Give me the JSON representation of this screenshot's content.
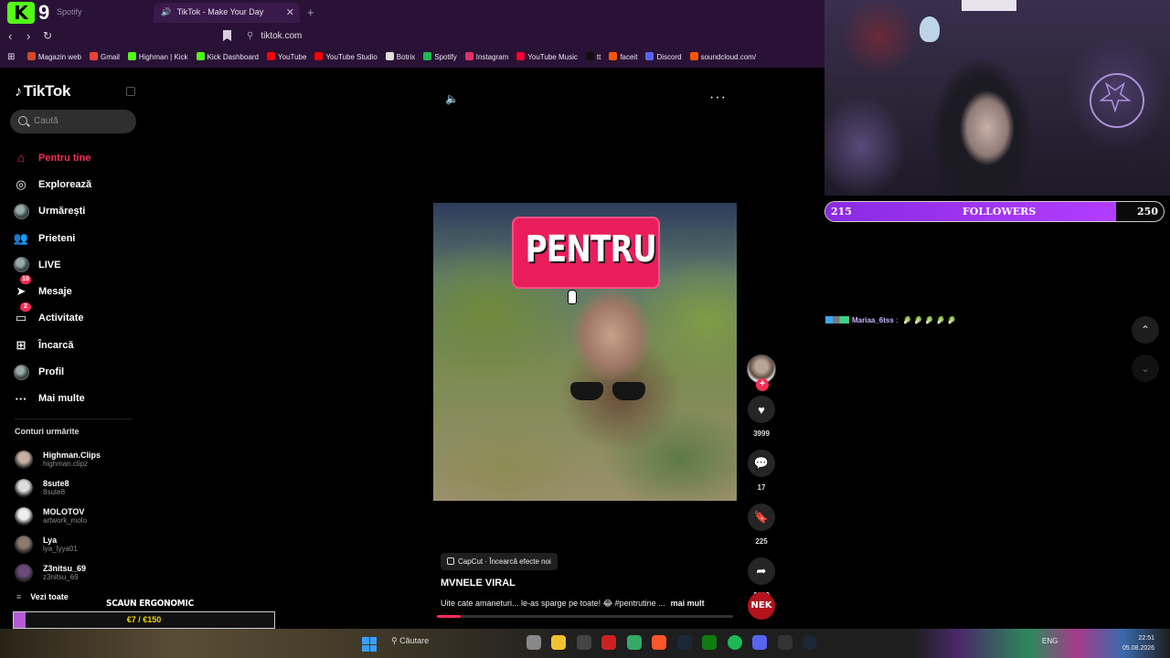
{
  "browser": {
    "inactive_tab_label": "Spotify",
    "active_tab_title": "TikTok - Make Your Day",
    "close_glyph": "✕",
    "new_tab_glyph": "+",
    "url": "tiktok.com",
    "logo_k": "K",
    "logo_9": "9",
    "bookmarks": [
      {
        "label": "Magazin web",
        "color": "#d04a2a"
      },
      {
        "label": "Gmail",
        "color": "#ea4335"
      },
      {
        "label": "Highman | Kick",
        "color": "#53fc18"
      },
      {
        "label": "Kick Dashboard",
        "color": "#53fc18"
      },
      {
        "label": "YouTube",
        "color": "#ff0000"
      },
      {
        "label": "YouTube Studio",
        "color": "#ff0000"
      },
      {
        "label": "Botrix",
        "color": "#dddddd"
      },
      {
        "label": "Spotify",
        "color": "#1db954"
      },
      {
        "label": "Instagram",
        "color": "#e1306c"
      },
      {
        "label": "YouTube Music",
        "color": "#ff0033"
      },
      {
        "label": "tt",
        "color": "#111111"
      },
      {
        "label": "faceit",
        "color": "#ff5500"
      },
      {
        "label": "Discord",
        "color": "#5865f2"
      },
      {
        "label": "soundcloud.com/",
        "color": "#ff5500"
      }
    ]
  },
  "tiktok": {
    "brand": "TikTok",
    "search_placeholder": "Caută",
    "menu": [
      {
        "label": "Pentru tine",
        "icon": "home-icon",
        "glyph": "⌂",
        "active": true
      },
      {
        "label": "Explorează",
        "icon": "compass-icon",
        "glyph": "◎"
      },
      {
        "label": "Urmărești",
        "icon": "following-avatar-icon",
        "glyph": ""
      },
      {
        "label": "Prieteni",
        "icon": "friends-icon",
        "glyph": "👥"
      },
      {
        "label": "LIVE",
        "icon": "live-avatar-icon",
        "glyph": ""
      },
      {
        "label": "Mesaje",
        "icon": "messages-icon",
        "glyph": "➤",
        "badge": "10"
      },
      {
        "label": "Activitate",
        "icon": "activity-icon",
        "glyph": "▭",
        "badge": "2"
      },
      {
        "label": "Încarcă",
        "icon": "upload-icon",
        "glyph": "⊞"
      },
      {
        "label": "Profil",
        "icon": "profile-avatar-icon",
        "glyph": ""
      },
      {
        "label": "Mai multe",
        "icon": "more-icon",
        "glyph": "···"
      }
    ],
    "following_title": "Conturi urmărite",
    "following": [
      {
        "name": "Highman.Clips",
        "handle": "highman.clipz",
        "color": "#c8b0a4"
      },
      {
        "name": "8sute8",
        "handle": "8sute8",
        "color": "#dddddd"
      },
      {
        "name": "MOLOTOV",
        "handle": "artwork_molo",
        "color": "#eeeeee"
      },
      {
        "name": "Lya",
        "handle": "lya_lyya01",
        "color": "#8a7a70"
      },
      {
        "name": "Z3nitsu_69",
        "handle": "z3nitsu_69",
        "color": "#6a4a7a"
      }
    ],
    "see_all": "Vezi toate",
    "video": {
      "caption_overlay": "PENTRU",
      "capcut": "CapCut · Încearcă efecte noi",
      "author": "MVNELE VIRAL",
      "description": "Uite cate amaneturi... le-as sparge pe toate! 😂 #pentrutine ...",
      "more": "mai mult",
      "progress": 0.08
    },
    "actions": [
      {
        "name": "like",
        "icon": "heart-icon",
        "glyph": "♥",
        "count": "3999"
      },
      {
        "name": "comment",
        "icon": "comment-icon",
        "glyph": "💬",
        "count": "17"
      },
      {
        "name": "save",
        "icon": "bookmark-icon",
        "glyph": "🔖",
        "count": "225"
      },
      {
        "name": "share",
        "icon": "share-icon",
        "glyph": "➦",
        "count": "2829"
      }
    ],
    "follow_plus": "+",
    "sound_disc": "NEK"
  },
  "stream": {
    "followers_label": "FOLLOWERS",
    "followers_current": "215",
    "followers_goal": "250",
    "followers_fraction": 0.86,
    "chat": {
      "user": "Mariaa_6tss",
      "emotes": "🥬 🥬 🥬 🥬 🥬"
    },
    "promo_title": "SCAUN ERGONOMIC",
    "promo_progress_text": "€7 / €150",
    "promo_fraction": 0.047
  },
  "taskbar": {
    "search": "Căutare",
    "lang": "ENG",
    "time": "22:51",
    "date": "05.08.2026"
  }
}
